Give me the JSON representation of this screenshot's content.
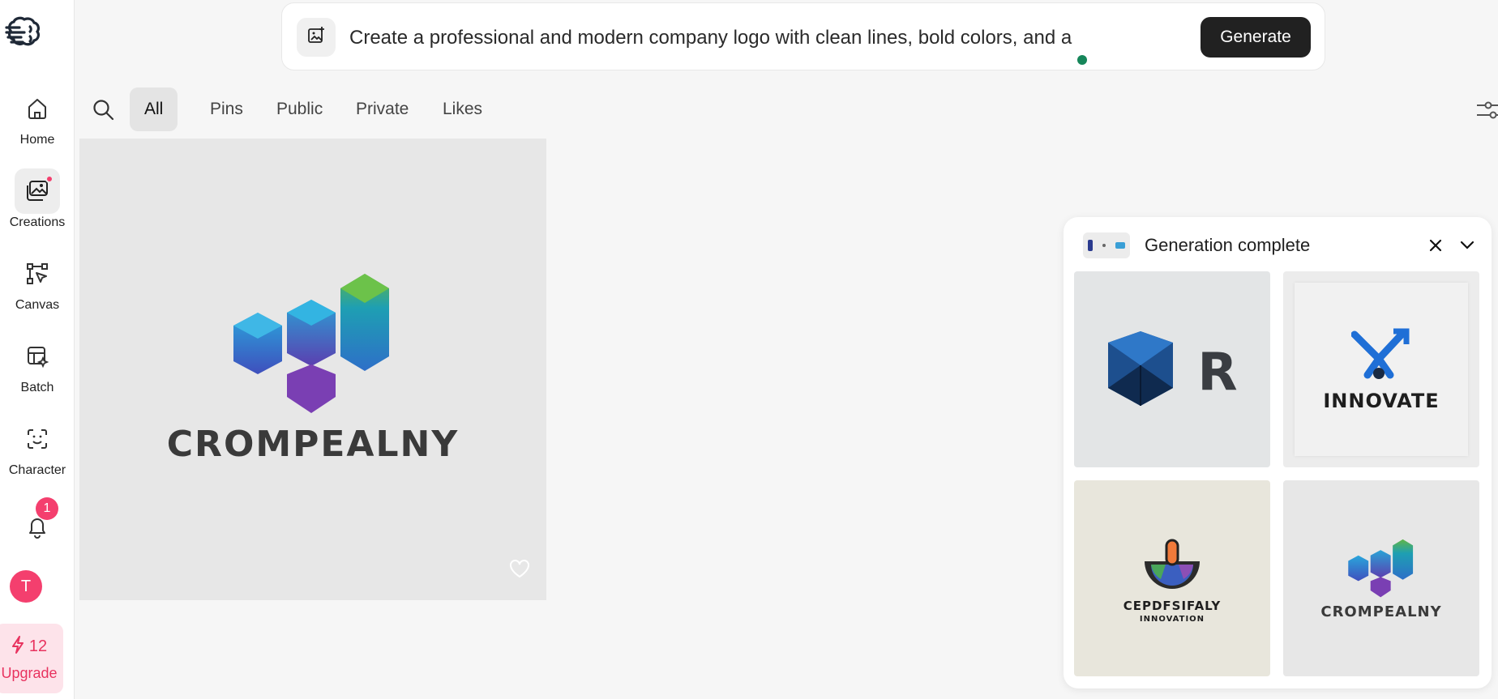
{
  "sidebar": {
    "brand_icon": "brain-logo-icon",
    "items": [
      {
        "label": "Home",
        "icon": "home-icon"
      },
      {
        "label": "Creations",
        "icon": "image-gallery-icon",
        "active": true
      },
      {
        "label": "Canvas",
        "icon": "canvas-icon"
      },
      {
        "label": "Batch",
        "icon": "batch-icon"
      },
      {
        "label": "Character",
        "icon": "character-icon"
      }
    ],
    "notifications_badge": "1",
    "avatar_initial": "T",
    "credits": "12",
    "upgrade_label": "Upgrade"
  },
  "prompt": {
    "text": "Create a professional and modern company logo with clean lines, bold colors, and a",
    "generate_label": "Generate"
  },
  "tabs": [
    {
      "label": "All",
      "active": true
    },
    {
      "label": "Pins"
    },
    {
      "label": "Public"
    },
    {
      "label": "Private"
    },
    {
      "label": "Likes"
    }
  ],
  "main_card": {
    "wordmark": "CROMPEALNY"
  },
  "generation_panel": {
    "title": "Generation complete",
    "results": [
      {
        "wordmark": "R"
      },
      {
        "wordmark": "INNOVATE"
      },
      {
        "wordmark": "CEPDFSIFALY",
        "tagline": "INNOVATION"
      },
      {
        "wordmark": "CROMPEALNY"
      }
    ]
  },
  "colors": {
    "accent_pink": "#f43f6e",
    "dark_button": "#212121",
    "status_green": "#16865a"
  }
}
